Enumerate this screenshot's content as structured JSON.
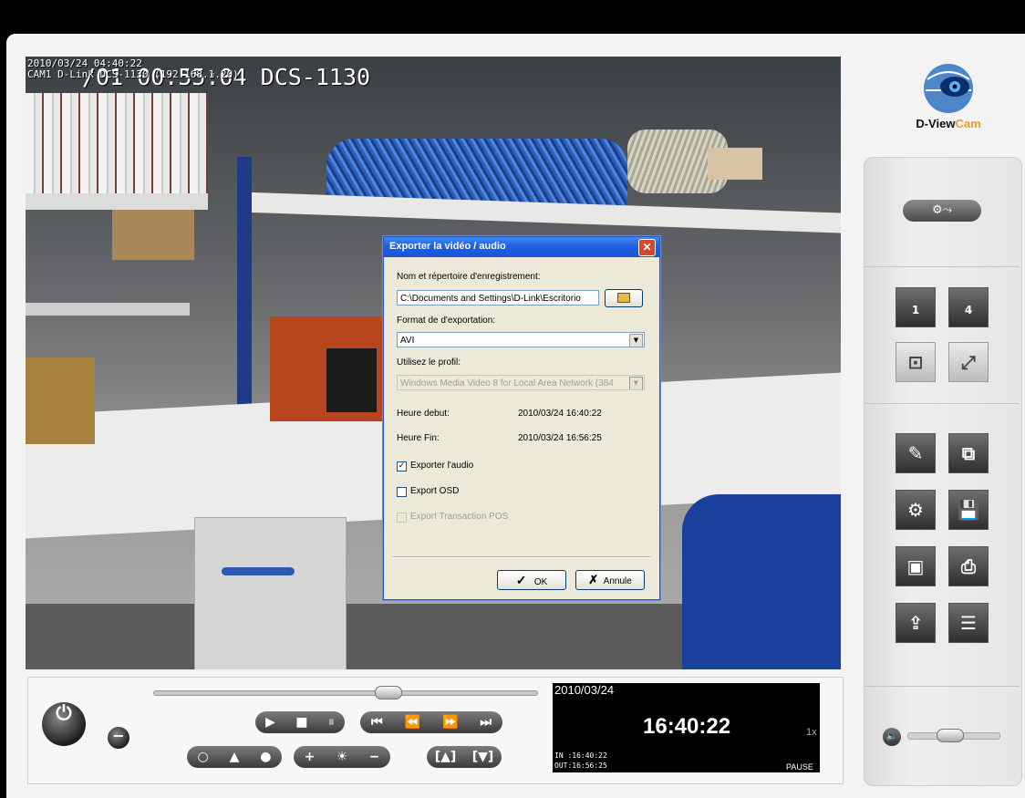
{
  "osd": {
    "line1": "2010/03/24 04:40:22",
    "line2": "CAM1 D-Link DCS-1130 (192.168.1.20)",
    "big": "/01 00:55:04 DCS-1130"
  },
  "dialog": {
    "title": "Exporter la vidéo / audio",
    "path_label": "Nom et répertoire d'enregistrement:",
    "path_value": "C:\\Documents and Settings\\D-Link\\Escritorio",
    "format_label": "Format de d'exportation:",
    "format_value": "AVI",
    "profile_label": "Utilisez le profil:",
    "profile_value": "Windows Media Video 8 for Local Area Network (384",
    "start_label": "Heure debut:",
    "start_value": "2010/03/24 16:40:22",
    "end_label": "Heure Fin:",
    "end_value": "2010/03/24 16:56:25",
    "audio_label": "Exporter l'audio",
    "audio_checked": true,
    "osd_label": "Export OSD",
    "osd_checked": false,
    "pos_label": "Export Transaction POS",
    "pos_checked": false,
    "ok_label": "OK",
    "cancel_label": "Annule"
  },
  "logo": {
    "brand": "D-View",
    "brand_accent": "Cam"
  },
  "playback": {
    "date": "2010/03/24",
    "time": "16:40:22",
    "speed": "1x",
    "in_time": "IN :16:40:22",
    "out_time": "OUT:16:56:25",
    "state": "PAUSE",
    "progress": 0.62,
    "volume": 0.45
  },
  "colors": {
    "dialog_title": "#1f5fe2",
    "accent": "#f39c1f"
  },
  "icons": {
    "layout_single": "1",
    "layout_quad": "4"
  }
}
